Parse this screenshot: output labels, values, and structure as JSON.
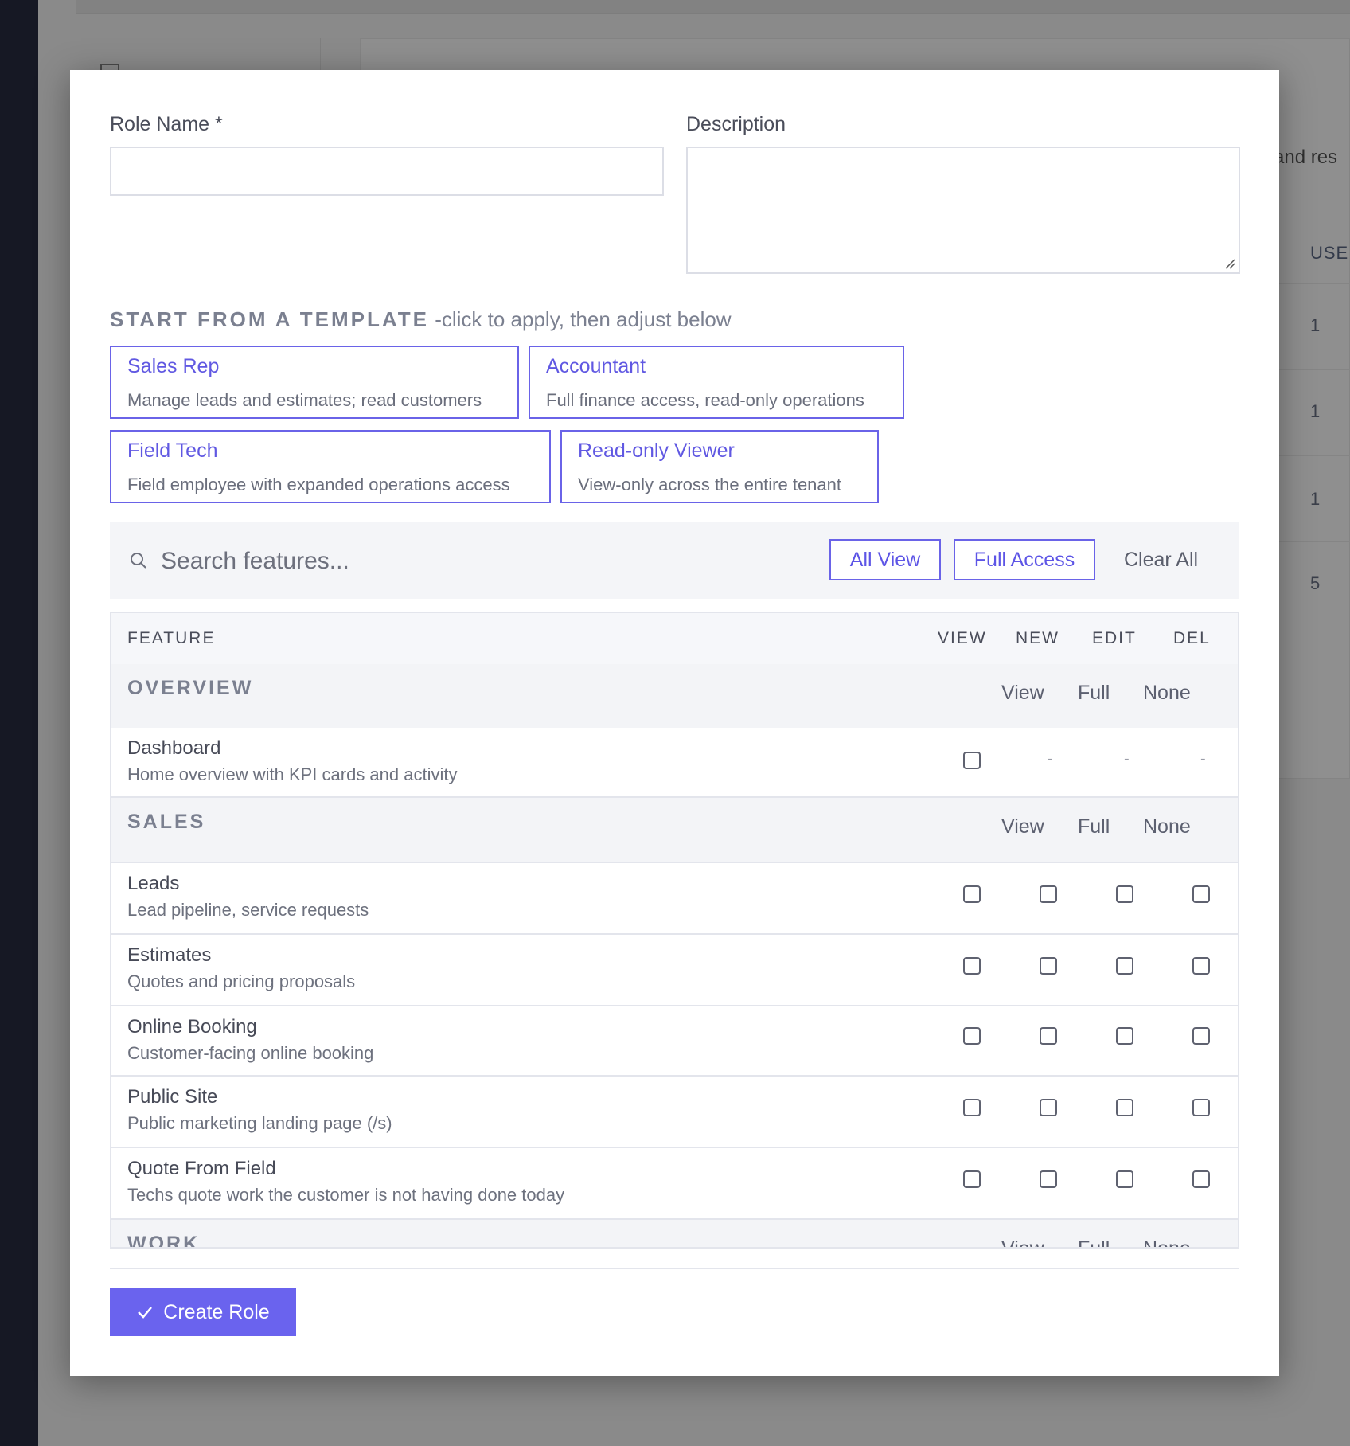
{
  "background": {
    "text_fragment": "and res",
    "column_header": "USE",
    "row_values": [
      "1",
      "1",
      "1",
      "5"
    ]
  },
  "form": {
    "role_name_label": "Role Name *",
    "role_name_value": "",
    "description_label": "Description",
    "description_value": ""
  },
  "templates": {
    "heading": "START FROM A TEMPLATE",
    "hint": "-click to apply, then adjust below",
    "items": [
      {
        "title": "Sales Rep",
        "description": "Manage leads and estimates; read customers"
      },
      {
        "title": "Accountant",
        "description": "Full finance access, read-only operations"
      },
      {
        "title": "Field Tech",
        "description": "Field employee with expanded operations access"
      },
      {
        "title": "Read-only Viewer",
        "description": "View-only across the entire tenant"
      }
    ]
  },
  "toolbar": {
    "search_placeholder": "Search features...",
    "all_view_label": "All View",
    "full_access_label": "Full Access",
    "clear_all_label": "Clear All"
  },
  "table": {
    "headers": {
      "feature": "FEATURE",
      "view": "VIEW",
      "new": "NEW",
      "edit": "EDIT",
      "del": "DEL"
    },
    "group_actions": {
      "view": "View",
      "full": "Full",
      "none": "None"
    },
    "groups": [
      {
        "name": "OVERVIEW",
        "features": [
          {
            "name": "Dashboard",
            "description": "Home overview with KPI cards and activity",
            "view_only": true,
            "dash": "-"
          }
        ]
      },
      {
        "name": "SALES",
        "features": [
          {
            "name": "Leads",
            "description": "Lead pipeline, service requests"
          },
          {
            "name": "Estimates",
            "description": "Quotes and pricing proposals"
          },
          {
            "name": "Online Booking",
            "description": "Customer-facing online booking"
          },
          {
            "name": "Public Site",
            "description": "Public marketing landing page (/s)"
          },
          {
            "name": "Quote From Field",
            "description": "Techs quote work the customer is not having done today"
          }
        ]
      },
      {
        "name": "WORK",
        "features": []
      }
    ]
  },
  "footer": {
    "create_label": "Create Role"
  },
  "colors": {
    "accent": "#6a63ee",
    "overlay": "#8a8a8a",
    "sidebar": "#161824"
  }
}
